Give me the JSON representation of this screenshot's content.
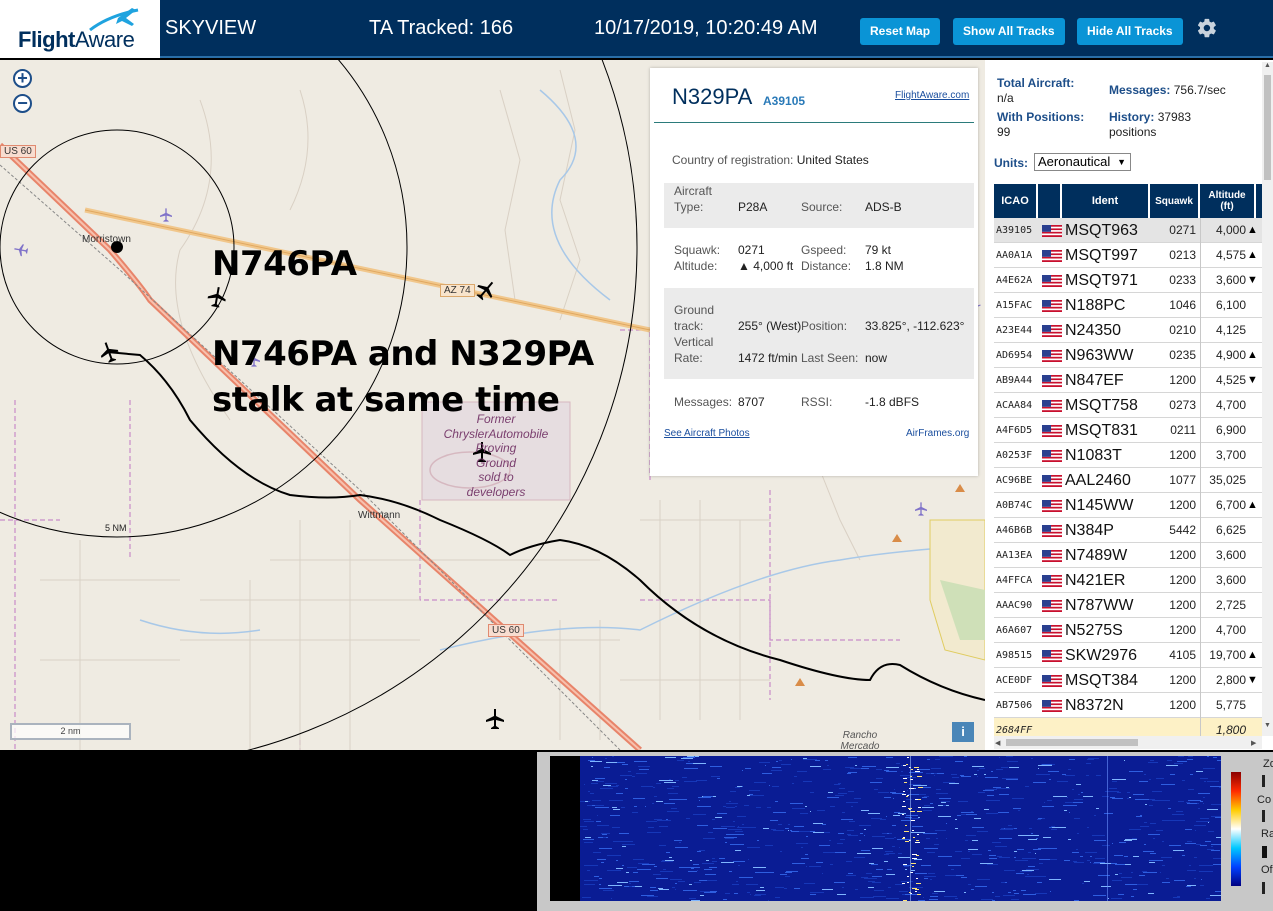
{
  "header": {
    "logo_flight": "Flight",
    "logo_aware": "Aware",
    "app_name": "SKYVIEW",
    "tracked": "TA Tracked: 166",
    "datetime": "10/17/2019, 10:20:49 AM",
    "btn_reset": "Reset Map",
    "btn_show": "Show All Tracks",
    "btn_hide": "Hide All Tracks",
    "settings_icon": "gear-icon"
  },
  "map": {
    "zoom_in": "+",
    "zoom_out": "−",
    "place_morristown": "Morristown",
    "place_wittmann": "Wittmann",
    "place_rancho": "Rancho Mercado",
    "highway_us60_top": "US 60",
    "highway_us60_bottom": "US 60",
    "highway_az74": "AZ 74",
    "poi_former": "Former",
    "poi_chrysler": "ChryslerAutomobile",
    "poi_proving": "Proving",
    "poi_ground": "Ground",
    "poi_sold": "sold to",
    "poi_developers": "developers",
    "ring_label": "5 NM",
    "scale_label": "2 nm",
    "info_button": "i",
    "annotation_1": "N746PA",
    "annotation_2_line1": "N746PA and N329PA",
    "annotation_2_line2": "stalk at same time"
  },
  "aircraft_info": {
    "registration": "N329PA",
    "icao": "A39105",
    "flightaware_link": "FlightAware.com",
    "country_label": "Country of registration:",
    "country_value": "United States",
    "type_label_1": "Aircraft",
    "type_label_2": "Type:",
    "type_value": "P28A",
    "source_label": "Source:",
    "source_value": "ADS-B",
    "squawk_label": "Squawk:",
    "squawk_value": "0271",
    "altitude_label": "Altitude:",
    "altitude_value": "▲ 4,000 ft",
    "gspeed_label": "Gspeed:",
    "gspeed_value": "79 kt",
    "distance_label": "Distance:",
    "distance_value": "1.8 NM",
    "ground_label_1": "Ground",
    "ground_label_2": "track:",
    "ground_value": "255° (West)",
    "position_label": "Position:",
    "position_value": "33.825°, -112.623°",
    "vertical_label_1": "Vertical",
    "vertical_label_2": "Rate:",
    "vertical_value": "1472 ft/min",
    "lastseen_label": "Last Seen:",
    "lastseen_value": "now",
    "messages_label": "Messages:",
    "messages_value": "8707",
    "rssi_label": "RSSI:",
    "rssi_value": "-1.8 dBFS",
    "photos_link": "See Aircraft Photos",
    "airframes_link": "AirFrames.org"
  },
  "stats": {
    "total_label": "Total Aircraft:",
    "total_value": "n/a",
    "messages_label": "Messages:",
    "messages_value": "756.7/sec",
    "positions_label": "With Positions:",
    "positions_value": "99",
    "history_label": "History:",
    "history_value_1": "37983",
    "history_value_2": "positions",
    "units_label": "Units:",
    "units_value": "Aeronautical"
  },
  "table": {
    "columns": [
      "ICAO",
      "Ident",
      "Squawk",
      "Altitude (ft)"
    ],
    "rows": [
      {
        "icao": "A39105",
        "ident": "MSQT963",
        "squawk": "0271",
        "altitude": "4,000",
        "trend": "▲"
      },
      {
        "icao": "AA0A1A",
        "ident": "MSQT997",
        "squawk": "0213",
        "altitude": "4,575",
        "trend": "▲"
      },
      {
        "icao": "A4E62A",
        "ident": "MSQT971",
        "squawk": "0233",
        "altitude": "3,600",
        "trend": "▼"
      },
      {
        "icao": "A15FAC",
        "ident": "N188PC",
        "squawk": "1046",
        "altitude": "6,100",
        "trend": ""
      },
      {
        "icao": "A23E44",
        "ident": "N24350",
        "squawk": "0210",
        "altitude": "4,125",
        "trend": ""
      },
      {
        "icao": "AD6954",
        "ident": "N963WW",
        "squawk": "0235",
        "altitude": "4,900",
        "trend": "▲"
      },
      {
        "icao": "AB9A44",
        "ident": "N847EF",
        "squawk": "1200",
        "altitude": "4,525",
        "trend": "▼"
      },
      {
        "icao": "ACAA84",
        "ident": "MSQT758",
        "squawk": "0273",
        "altitude": "4,700",
        "trend": ""
      },
      {
        "icao": "A4F6D5",
        "ident": "MSQT831",
        "squawk": "0211",
        "altitude": "6,900",
        "trend": ""
      },
      {
        "icao": "A0253F",
        "ident": "N1083T",
        "squawk": "1200",
        "altitude": "3,700",
        "trend": ""
      },
      {
        "icao": "AC96BE",
        "ident": "AAL2460",
        "squawk": "1077",
        "altitude": "35,025",
        "trend": ""
      },
      {
        "icao": "A0B74C",
        "ident": "N145WW",
        "squawk": "1200",
        "altitude": "6,700",
        "trend": "▲"
      },
      {
        "icao": "A46B6B",
        "ident": "N384P",
        "squawk": "5442",
        "altitude": "6,625",
        "trend": ""
      },
      {
        "icao": "AA13EA",
        "ident": "N7489W",
        "squawk": "1200",
        "altitude": "3,600",
        "trend": ""
      },
      {
        "icao": "A4FFCA",
        "ident": "N421ER",
        "squawk": "1200",
        "altitude": "3,600",
        "trend": ""
      },
      {
        "icao": "AAAC90",
        "ident": "N787WW",
        "squawk": "1200",
        "altitude": "2,725",
        "trend": ""
      },
      {
        "icao": "A6A607",
        "ident": "N5275S",
        "squawk": "1200",
        "altitude": "4,700",
        "trend": ""
      },
      {
        "icao": "A98515",
        "ident": "SKW2976",
        "squawk": "4105",
        "altitude": "19,700",
        "trend": "▲"
      },
      {
        "icao": "ACE0DF",
        "ident": "MSQT384",
        "squawk": "1200",
        "altitude": "2,800",
        "trend": "▼"
      },
      {
        "icao": "AB7506",
        "ident": "N8372N",
        "squawk": "1200",
        "altitude": "5,775",
        "trend": ""
      },
      {
        "icao": "2684FF",
        "ident": "",
        "squawk": "",
        "altitude": "1,800",
        "trend": ""
      }
    ]
  },
  "sdr": {
    "label_1": "Zo",
    "label_2": "Co",
    "label_3": "Ra",
    "label_4": "Of"
  },
  "colors": {
    "header_bg": "#002f5d",
    "button_bg": "#0a94d6",
    "map_bg": "#efebe2",
    "highway": "#e8846a"
  }
}
